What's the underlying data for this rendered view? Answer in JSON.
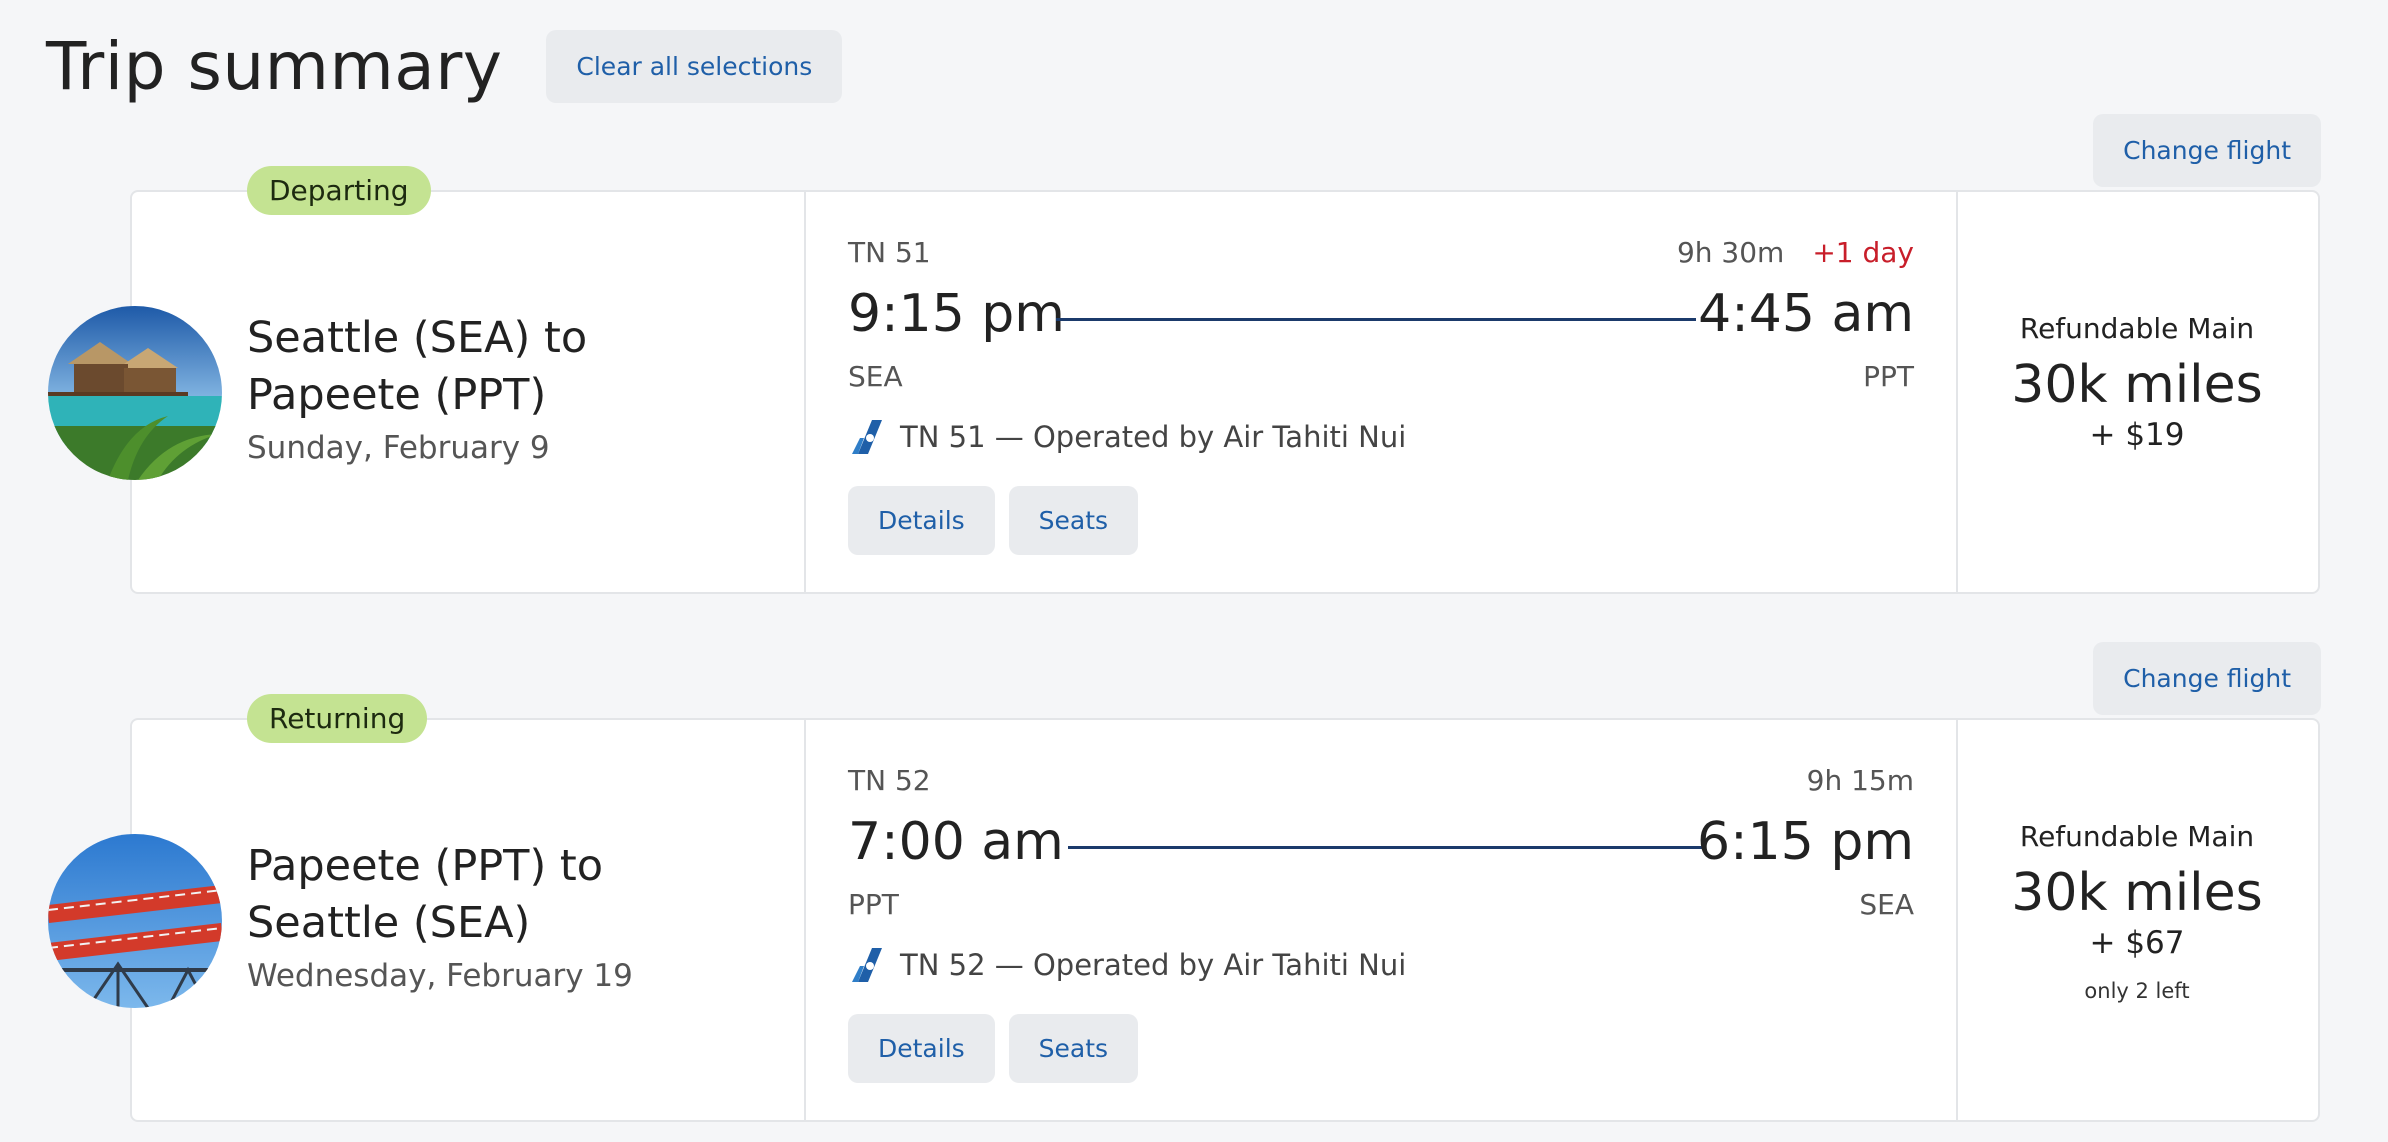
{
  "header": {
    "title": "Trip summary",
    "clear_label": "Clear all selections"
  },
  "flights": [
    {
      "badge": "Departing",
      "change_label": "Change flight",
      "route": "Seattle (SEA) to Papeete (PPT)",
      "date": "Sunday, February 9",
      "image_icon": "overwater-bungalow-photo",
      "flight_number": "TN 51",
      "duration": "9h 30m",
      "day_change": "+1 day",
      "depart_time": "9:15 pm",
      "arrive_time": "4:45 am",
      "depart_code": "SEA",
      "arrive_code": "PPT",
      "operated_by": "TN 51 — Operated by Air Tahiti Nui",
      "details_label": "Details",
      "seats_label": "Seats",
      "fare_class": "Refundable Main",
      "miles": "30k miles",
      "tax": "+ $19",
      "availability": ""
    },
    {
      "badge": "Returning",
      "change_label": "Change flight",
      "route": "Papeete (PPT) to Seattle (SEA)",
      "date": "Wednesday, February 19",
      "image_icon": "public-market-sign-photo",
      "flight_number": "TN 52",
      "duration": "9h 15m",
      "day_change": "",
      "depart_time": "7:00 am",
      "arrive_time": "6:15 pm",
      "depart_code": "PPT",
      "arrive_code": "SEA",
      "operated_by": "TN 52 — Operated by Air Tahiti Nui",
      "details_label": "Details",
      "seats_label": "Seats",
      "fare_class": "Refundable Main",
      "miles": "30k miles",
      "tax": "+ $67",
      "availability": "only 2 left"
    }
  ],
  "colors": {
    "accent": "#1f5fa8",
    "badge": "#c4e392",
    "alert": "#c81e2a",
    "route_line": "#1b3a6b"
  }
}
